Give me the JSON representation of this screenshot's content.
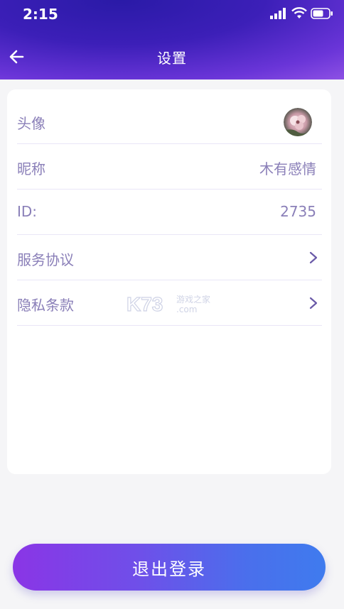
{
  "status_bar": {
    "time": "2:15"
  },
  "header": {
    "title": "设置"
  },
  "rows": [
    {
      "label": "头像",
      "value": ""
    },
    {
      "label": "昵称",
      "value": "木有感情"
    },
    {
      "label": "ID:",
      "value": "2735"
    },
    {
      "label": "服务协议",
      "value": ""
    },
    {
      "label": "隐私条款",
      "value": ""
    }
  ],
  "watermark": {
    "brand": "K73",
    "line1": "游戏之家",
    "line2": ".com"
  },
  "logout_button": {
    "label": "退出登录"
  },
  "colors": {
    "header_start": "#2a1aa7",
    "header_end": "#b06cf0",
    "text_muted": "#8a7fb8",
    "button_start": "#8a35e6",
    "button_end": "#3f7bee"
  }
}
